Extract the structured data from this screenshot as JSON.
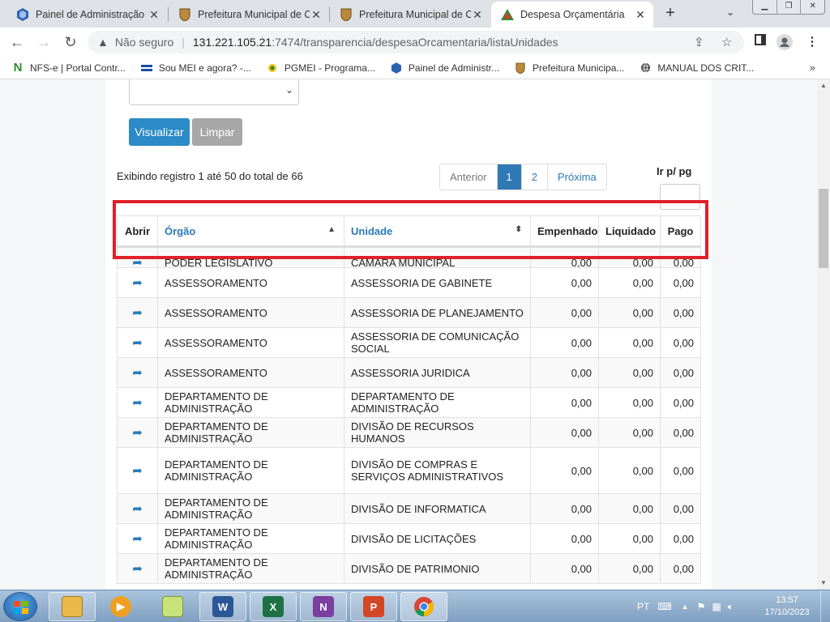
{
  "tabs": [
    {
      "title": "Painel de Administração"
    },
    {
      "title": "Prefeitura Municipal de C"
    },
    {
      "title": "Prefeitura Municipal de C"
    },
    {
      "title": "Despesa Orçamentária"
    }
  ],
  "address": {
    "security_label": "Não seguro",
    "host": "131.221.105.21",
    "path": ":7474/transparencia/despesaOrcamentaria/listaUnidades"
  },
  "bookmarks": [
    {
      "label": "NFS-e | Portal Contr..."
    },
    {
      "label": "Sou MEI e agora? -..."
    },
    {
      "label": "PGMEI - Programa..."
    },
    {
      "label": "Painel de Administr..."
    },
    {
      "label": "Prefeitura Municipa..."
    },
    {
      "label": "MANUAL DOS CRIT..."
    }
  ],
  "form": {
    "visualizar_label": "Visualizar",
    "limpar_label": "Limpar"
  },
  "listing": {
    "info": "Exibindo registro 1 até 50 do total de 66",
    "pager": {
      "prev": "Anterior",
      "page1": "1",
      "page2": "2",
      "next": "Próxima"
    },
    "goto_label": "Ir p/ pg"
  },
  "table": {
    "headers": {
      "abrir": "Abrir",
      "orgao": "Órgão",
      "unidade": "Unidade",
      "empenhado": "Empenhado",
      "liquidado": "Liquidado",
      "pago": "Pago"
    },
    "rows": [
      {
        "orgao": "PODER LEGISLATIVO",
        "unidade": "CAMARA MUNICIPAL",
        "empenhado": "0,00",
        "liquidado": "0,00",
        "pago": "0,00"
      },
      {
        "orgao": "ASSESSORAMENTO",
        "unidade": "ASSESSORIA DE GABINETE",
        "empenhado": "0,00",
        "liquidado": "0,00",
        "pago": "0,00"
      },
      {
        "orgao": "ASSESSORAMENTO",
        "unidade": "ASSESSORIA DE PLANEJAMENTO",
        "empenhado": "0,00",
        "liquidado": "0,00",
        "pago": "0,00"
      },
      {
        "orgao": "ASSESSORAMENTO",
        "unidade": "ASSESSORIA DE COMUNICAÇÃO SOCIAL",
        "empenhado": "0,00",
        "liquidado": "0,00",
        "pago": "0,00"
      },
      {
        "orgao": "ASSESSORAMENTO",
        "unidade": "ASSESSORIA JURIDICA",
        "empenhado": "0,00",
        "liquidado": "0,00",
        "pago": "0,00"
      },
      {
        "orgao": "DEPARTAMENTO DE ADMINISTRAÇÃO",
        "unidade": "DEPARTAMENTO DE ADMINISTRAÇÃO",
        "empenhado": "0,00",
        "liquidado": "0,00",
        "pago": "0,00"
      },
      {
        "orgao": "DEPARTAMENTO DE ADMINISTRAÇÃO",
        "unidade": "DIVISÃO DE RECURSOS HUMANOS",
        "empenhado": "0,00",
        "liquidado": "0,00",
        "pago": "0,00"
      },
      {
        "orgao": "DEPARTAMENTO DE ADMINISTRAÇÃO",
        "unidade": "DIVISÃO DE COMPRAS E SERVIÇOS ADMINISTRATIVOS",
        "empenhado": "0,00",
        "liquidado": "0,00",
        "pago": "0,00"
      },
      {
        "orgao": "DEPARTAMENTO DE ADMINISTRAÇÃO",
        "unidade": "DIVISÃO DE INFORMATICA",
        "empenhado": "0,00",
        "liquidado": "0,00",
        "pago": "0,00"
      },
      {
        "orgao": "DEPARTAMENTO DE ADMINISTRAÇÃO",
        "unidade": "DIVISÃO DE LICITAÇÕES",
        "empenhado": "0,00",
        "liquidado": "0,00",
        "pago": "0,00"
      },
      {
        "orgao": "DEPARTAMENTO DE ADMINISTRAÇÃO",
        "unidade": "DIVISÃO DE PATRIMONIO",
        "empenhado": "0,00",
        "liquidado": "0,00",
        "pago": "0,00"
      }
    ]
  },
  "taskbar": {
    "language": "PT",
    "time": "13:57",
    "date": "17/10/2023"
  },
  "colors": {
    "primary": "#2a8bc6",
    "link": "#2a7ab8",
    "highlight": "#e0202a"
  },
  "icons": {
    "open_row": "share-arrow-icon"
  }
}
